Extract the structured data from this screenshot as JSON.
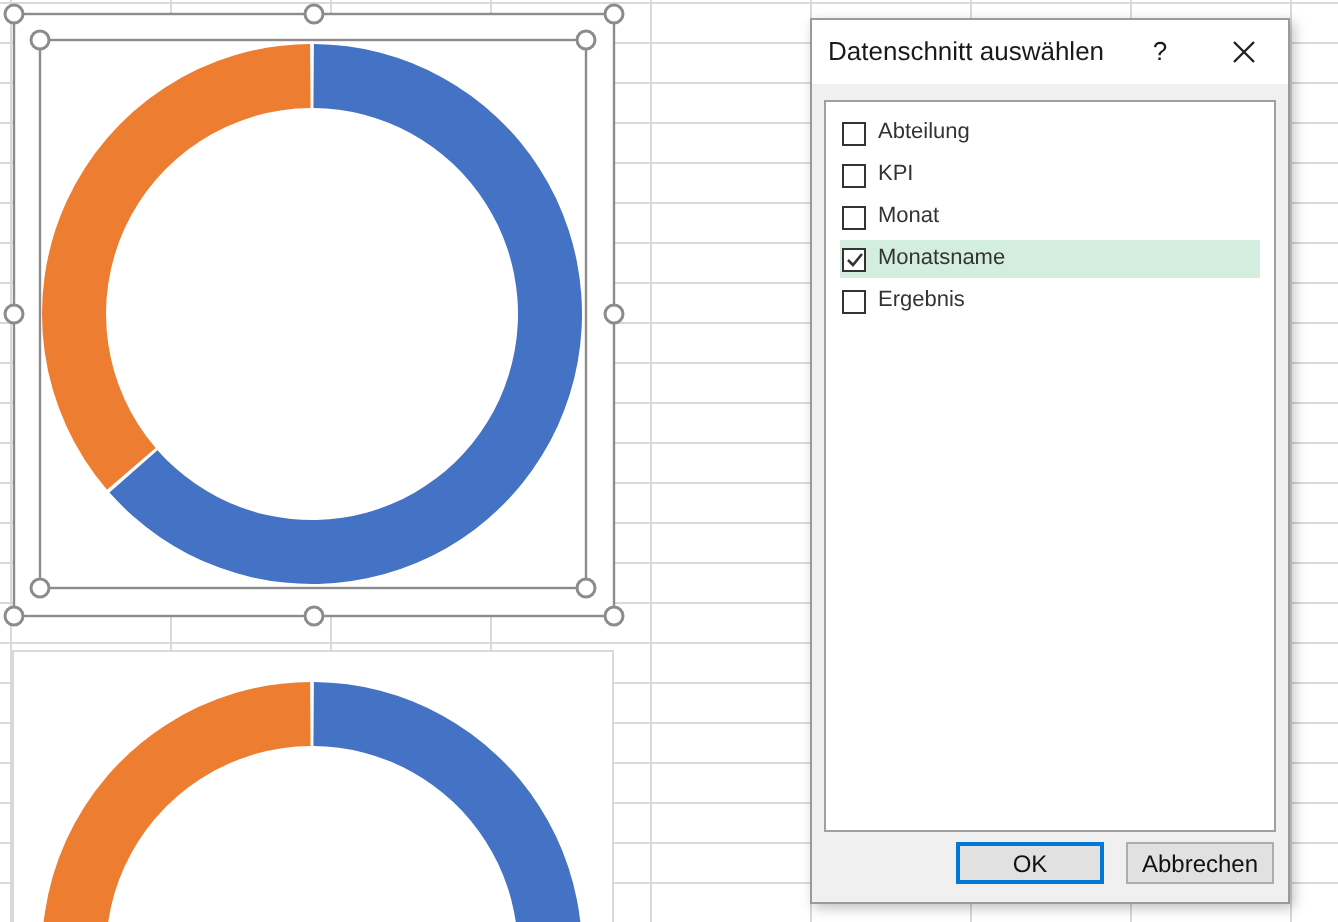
{
  "dialog": {
    "title": "Datenschnitt auswählen",
    "help": "?",
    "fields": [
      {
        "label": "Abteilung",
        "checked": false,
        "selected": false
      },
      {
        "label": "KPI",
        "checked": false,
        "selected": false
      },
      {
        "label": "Monat",
        "checked": false,
        "selected": false
      },
      {
        "label": "Monatsname",
        "checked": true,
        "selected": true
      },
      {
        "label": "Ergebnis",
        "checked": false,
        "selected": false
      }
    ],
    "buttons": [
      {
        "label": "OK",
        "default": true
      },
      {
        "label": "Abbrechen",
        "default": false
      }
    ]
  }
}
